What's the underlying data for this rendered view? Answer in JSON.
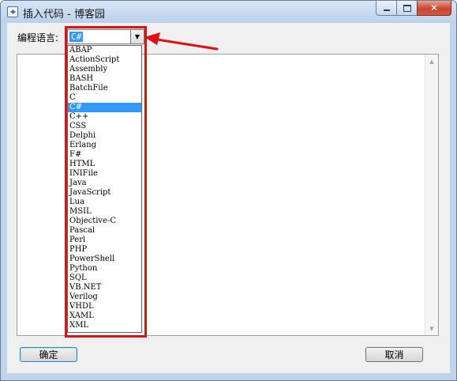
{
  "window": {
    "title": "插入代码 - 博客园",
    "close_glyph": "✕"
  },
  "form": {
    "language_label": "编程语言:",
    "selected_language": "C#",
    "combo_arrow_glyph": "▼"
  },
  "dropdown": {
    "options": [
      "ABAP",
      "ActionScript",
      "Assembly",
      "BASH",
      "BatchFile",
      "C",
      "C#",
      "C++",
      "CSS",
      "Delphi",
      "Erlang",
      "F#",
      "HTML",
      "INIFile",
      "Java",
      "JavaScript",
      "Lua",
      "MSIL",
      "Objective-C",
      "Pascal",
      "Perl",
      "PHP",
      "PowerShell",
      "Python",
      "SQL",
      "VB.NET",
      "Verilog",
      "VHDL",
      "XAML",
      "XML"
    ],
    "selected_index": 6
  },
  "buttons": {
    "ok_label": "确定",
    "cancel_label": "取消"
  },
  "scrollbar": {
    "up_glyph": "▲",
    "down_glyph": "▼"
  },
  "colors": {
    "annotation_red": "#e01010",
    "selection_blue": "#3399ff"
  }
}
